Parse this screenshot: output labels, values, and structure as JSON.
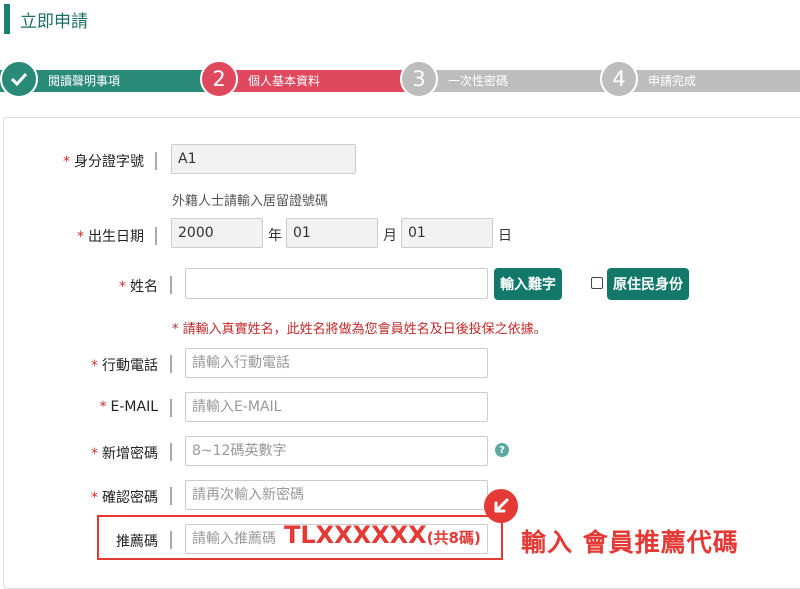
{
  "page": {
    "title": "立即申請"
  },
  "steps": [
    {
      "number": "✓",
      "label": "閱讀聲明事項",
      "state": "done",
      "color": "#2a8a78"
    },
    {
      "number": "2",
      "label": "個人基本資料",
      "state": "active",
      "color": "#e0485e"
    },
    {
      "number": "3",
      "label": "一次性密碼",
      "state": "pending",
      "color": "#bdbdbd"
    },
    {
      "number": "4",
      "label": "申請完成",
      "state": "pending",
      "color": "#bdbdbd"
    }
  ],
  "form": {
    "id_number": {
      "label": "身分證字號",
      "value": "A1",
      "hint": "外籍人士請輸入居留證號碼"
    },
    "birthday": {
      "label": "出生日期",
      "year": "2000",
      "month": "01",
      "day": "01",
      "year_unit": "年",
      "month_unit": "月",
      "day_unit": "日"
    },
    "name": {
      "label": "姓名",
      "value": "",
      "rare_char_button": "輸入難字",
      "aboriginal_label": "原住民身份",
      "warning": "* 請輸入真實姓名，此姓名將做為您會員姓名及日後投保之依據。"
    },
    "mobile": {
      "label": "行動電話",
      "placeholder": "請輸入行動電話"
    },
    "email": {
      "label": "E-MAIL",
      "placeholder": "請輸入E-MAIL"
    },
    "password": {
      "label": "新增密碼",
      "placeholder": "8~12碼英數字"
    },
    "confirm_password": {
      "label": "確認密碼",
      "placeholder": "請再次輸入新密碼"
    },
    "referral": {
      "label": "推薦碼",
      "placeholder": "請輸入推薦碼"
    },
    "required_mark": "*"
  },
  "overlay": {
    "code_text": "TLXXXXXX",
    "code_note": "(共8碼)",
    "annotation": "輸入 會員推薦代碼"
  },
  "colors": {
    "brand_green": "#12786a",
    "accent_red": "#e53935"
  }
}
